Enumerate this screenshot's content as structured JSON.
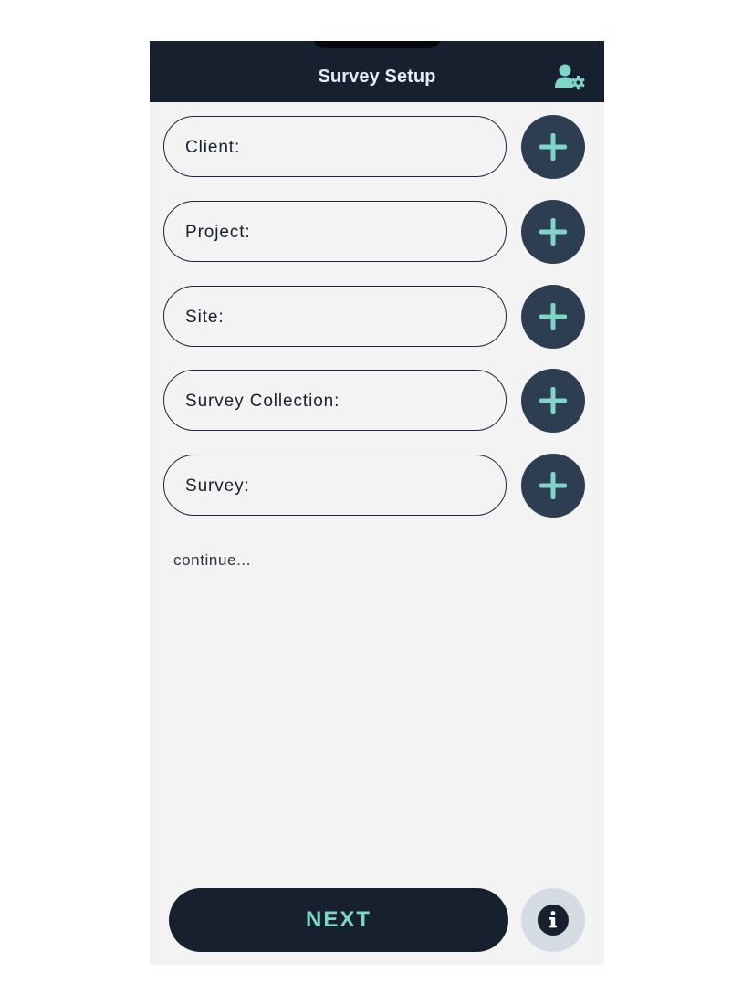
{
  "header": {
    "title": "Survey Setup",
    "settings_icon": "user-settings-icon"
  },
  "fields": [
    {
      "label": "Client:",
      "add_icon": "plus-icon"
    },
    {
      "label": "Project:",
      "add_icon": "plus-icon"
    },
    {
      "label": "Site:",
      "add_icon": "plus-icon"
    },
    {
      "label": "Survey Collection:",
      "add_icon": "plus-icon"
    },
    {
      "label": "Survey:",
      "add_icon": "plus-icon"
    }
  ],
  "continue_text": "continue...",
  "footer": {
    "next_label": "NEXT",
    "info_icon": "info-icon"
  },
  "colors": {
    "header_bg": "#16202e",
    "page_bg": "#f3f3f3",
    "accent": "#7ed6c6",
    "add_button_bg": "#2d3e52",
    "info_button_bg": "#d5dbe2"
  }
}
